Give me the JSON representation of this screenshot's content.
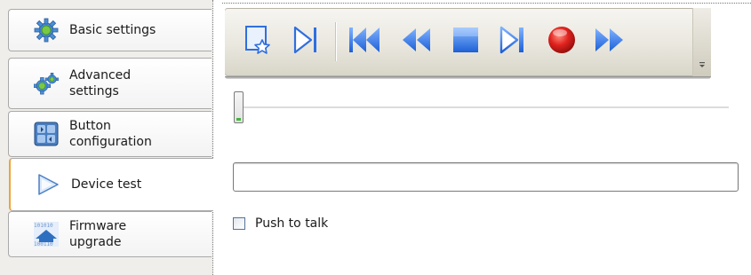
{
  "sidebar": {
    "tabs": [
      {
        "label": "Basic settings",
        "icon": "gear-icon",
        "active": false
      },
      {
        "label": "Advanced\nsettings",
        "icon": "gears-icon",
        "active": false
      },
      {
        "label": "Button\nconfiguration",
        "icon": "button-grid-icon",
        "active": false
      },
      {
        "label": "Device test",
        "icon": "play-triangle-icon",
        "active": true
      },
      {
        "label": "Firmware\nupgrade",
        "icon": "firmware-binary-icon",
        "active": false
      }
    ],
    "active_accent": "#f0a33a"
  },
  "toolbar": {
    "buttons": [
      {
        "icon": "bookmark-star-icon"
      },
      {
        "icon": "play-pause-icon"
      },
      {
        "icon": "skip-back-icon"
      },
      {
        "icon": "rewind-icon"
      },
      {
        "icon": "stop-icon"
      },
      {
        "icon": "play-end-icon"
      },
      {
        "icon": "record-icon"
      },
      {
        "icon": "fast-forward-icon"
      }
    ],
    "accent_blue": "#2f6fe0",
    "record_red": "#e0221e"
  },
  "slider": {
    "value_fraction": 0
  },
  "progress": {
    "value": ""
  },
  "push_to_talk": {
    "label": "Push to talk",
    "checked": false
  }
}
